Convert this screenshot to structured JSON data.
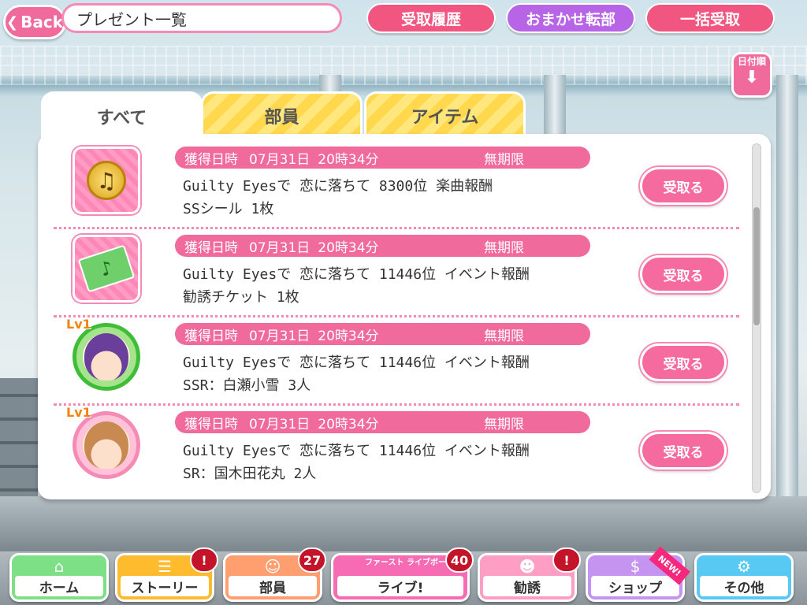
{
  "header": {
    "back_label": "Back",
    "title": "プレゼント一覧",
    "history_button": "受取履歴",
    "auto_button": "おまかせ転部",
    "receive_all_button": "一括受取",
    "sort_label": "日付順"
  },
  "tabs": [
    {
      "label": "すべて",
      "active": true
    },
    {
      "label": "部員",
      "active": false
    },
    {
      "label": "アイテム",
      "active": false
    }
  ],
  "presents": [
    {
      "date_label": "獲得日時",
      "date": "07月31日",
      "time": "20時34分",
      "expiry": "無期限",
      "line1": "Guilty Eyesで 恋に落ちて 8300位 楽曲報酬",
      "line2": "SSシール 1枚",
      "icon": "music-coin-icon",
      "receive_label": "受取る"
    },
    {
      "date_label": "獲得日時",
      "date": "07月31日",
      "time": "20時34分",
      "expiry": "無期限",
      "line1": "Guilty Eyesで 恋に落ちて 11446位 イベント報酬",
      "line2": "勧誘チケット 1枚",
      "icon": "ticket-icon",
      "receive_label": "受取る"
    },
    {
      "date_label": "獲得日時",
      "date": "07月31日",
      "time": "20時34分",
      "expiry": "無期限",
      "line1": "Guilty Eyesで 恋に落ちて 11446位 イベント報酬",
      "line2": "SSR：白瀬小雪 3人",
      "icon": "character-avatar-icon",
      "level": "Lv1",
      "receive_label": "受取る"
    },
    {
      "date_label": "獲得日時",
      "date": "07月31日",
      "time": "20時34分",
      "expiry": "無期限",
      "line1": "Guilty Eyesで 恋に落ちて 11446位 イベント報酬",
      "line2": "SR：国木田花丸 2人",
      "icon": "character-avatar-icon",
      "level": "Lv1",
      "receive_label": "受取る"
    }
  ],
  "nav": {
    "home": "ホーム",
    "story": "ストーリー",
    "member": "部員",
    "member_badge": "27",
    "live": "ライブ!",
    "live_sub": "ファースト ライブボーナス",
    "live_badge": "40",
    "solicit": "勧誘",
    "shop": "ショップ",
    "shop_tag": "NEW!",
    "other": "その他"
  },
  "colors": {
    "accent_pink": "#f06a9c",
    "accent_purple": "#b864e6",
    "tab_yellow": "#ffd84e"
  }
}
